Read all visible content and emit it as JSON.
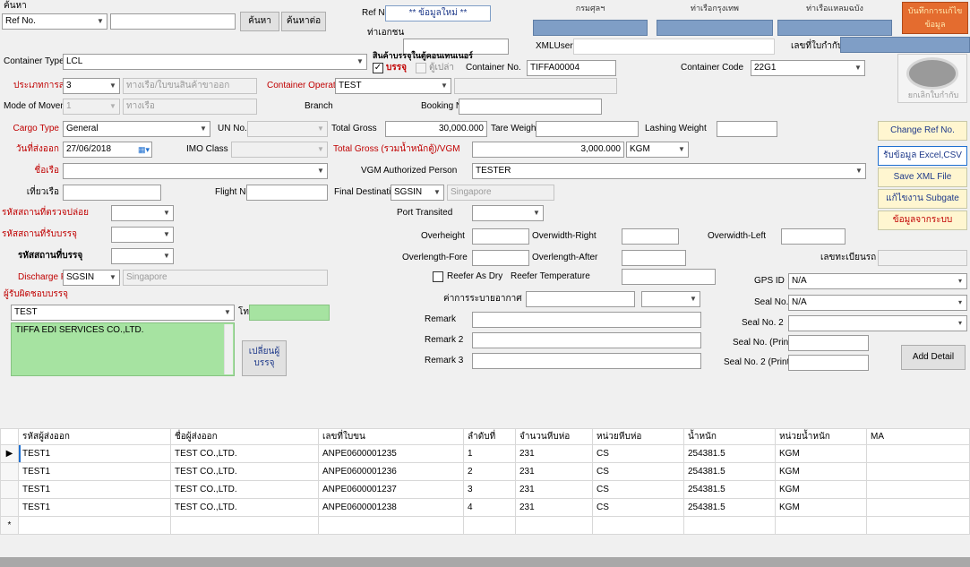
{
  "top": {
    "search_label": "ค้นหา",
    "search_field": "Ref No.",
    "search_value": "",
    "search_button": "ค้นหา",
    "advanced_search_button": "ค้นหาต่อ",
    "ref_no_label": "Ref No.",
    "ref_no_value": "** ข้อมูลใหม่ **",
    "col_status": "กรมศุลฯ",
    "col_sent": "ท่าเรือกรุงเทพ",
    "col_result": "ท่าเรือแหลมฉบัง",
    "save_button": "บันทึกการแก้ไขข้อมูล",
    "transporter_label": "ท่าเอกชน",
    "xml_user_label": "XMLUser ID",
    "reg_no_label": "เลขที่ใบกำกับฯ"
  },
  "container": {
    "type_label": "Container Type",
    "type_value": "LCL",
    "in_container_label": "สินค้าบรรจุในตู้คอนเทนเนอร์",
    "in_container_check": "บรรจุ",
    "empty_check": "ตู้เปล่า",
    "container_no_label": "Container No.",
    "container_no_value": "TIFFA00004",
    "container_code_label": "Container Code",
    "container_code_value": "22G1",
    "shipping_type_label": "ประเภทการส่งออก",
    "shipping_type_value": "3",
    "shipping_type_desc": "ทางเรือ/ใบขนสินค้าขาออก",
    "operator_label": "Container Operator",
    "operator_value": "TEST",
    "mode_label": "Mode of Movement",
    "mode_value": "1",
    "mode_desc": "ทางเรือ",
    "branch_label": "Branch",
    "booking_label": "Booking No.",
    "booking_value": ""
  },
  "cargo": {
    "cargo_type_label": "Cargo Type",
    "cargo_type_value": "General",
    "un_no_label": "UN No.",
    "total_gross_label": "Total Gross",
    "total_gross_value": "30,000.000",
    "tare_weight_label": "Tare Weight",
    "tare_weight_value": "",
    "lashing_weight_label": "Lashing Weight",
    "lashing_weight_value": "",
    "date_label": "วันที่ส่งออก",
    "date_value": "27/06/2018",
    "imo_label": "IMO Class",
    "vgm_label": "Total Gross (รวมน้ำหนักตู้)/VGM",
    "vgm_value": "3,000.000",
    "vgm_unit": "KGM",
    "vessel_label": "ชื่อเรือ",
    "vgm_auth_label": "VGM Authorized Person",
    "vgm_auth_value": "TESTER",
    "voyage_label": "เที่ยวเรือ",
    "flight_label": "Flight No.",
    "final_dest_label": "Final Destination",
    "final_dest_code": "SGSIN",
    "final_dest_name": "Singapore",
    "port_loading_label": "รหัสสถานที่ตรวจปล่อย",
    "port_transited_label": "Port Transited",
    "port_receive_label": "รหัสสถานที่รับบรรจุ",
    "overheight_label": "Overheight",
    "overwidth_right_label": "Overwidth-Right",
    "overwidth_left_label": "Overwidth-Left",
    "port_pack_label": "รหัสสถานที่บรรจุ",
    "overlength_fore_label": "Overlength-Fore",
    "overlength_after_label": "Overlength-After",
    "release_label": "เลขทะเบียนรถ",
    "discharge_label": "Discharge Port",
    "discharge_code": "SGSIN",
    "discharge_name": "Singapore",
    "reefer_label": "Reefer As Dry",
    "reefer_temp_label": "Reefer Temperature",
    "gps_label": "GPS ID",
    "gps_value": "N/A",
    "packer_label": "ผู้รับผิดชอบบรรจุ",
    "condition_label": "ค่าการระบายอากาศ",
    "seal_label": "Seal No.",
    "seal_value": "N/A",
    "packer_value": "TEST",
    "tel_label": "โทร",
    "remark_label": "Remark",
    "seal2_label": "Seal No. 2",
    "company_value": "TIFFA EDI SERVICES CO.,LTD.",
    "remark2_label": "Remark 2",
    "seal_print_label": "Seal No. (Print)",
    "edit_packer_button": "เปลี่ยนผู้บรรจุ",
    "remark3_label": "Remark 3",
    "seal2_print_label": "Seal No. 2 (Print)",
    "add_detail_button": "Add Detail"
  },
  "side": {
    "logo_caption": "ยกเลิกใบกำกับ",
    "change_ref": "Change Ref No.",
    "import_excel": "รับข้อมูล Excel,CSV",
    "save_xml": "Save XML File",
    "edit_subgate": "แก้ไขงาน Subgate",
    "more_info": "ข้อมูลจากระบบ"
  },
  "grid": {
    "headers": [
      "รหัสผู้ส่งออก",
      "ชื่อผู้ส่งออก",
      "เลขที่ใบขน",
      "ลำดับที่",
      "จำนวนหีบห่อ",
      "หน่วยหีบห่อ",
      "น้ำหนัก",
      "หน่วยน้ำหนัก",
      "MA"
    ],
    "rows": [
      [
        "TEST1",
        "TEST CO.,LTD.",
        "ANPE0600001235",
        "1",
        "231",
        "CS",
        "254381.5",
        "KGM",
        ""
      ],
      [
        "TEST1",
        "TEST CO.,LTD.",
        "ANPE0600001236",
        "2",
        "231",
        "CS",
        "254381.5",
        "KGM",
        ""
      ],
      [
        "TEST1",
        "TEST CO.,LTD.",
        "ANPE0600001237",
        "3",
        "231",
        "CS",
        "254381.5",
        "KGM",
        ""
      ],
      [
        "TEST1",
        "TEST CO.,LTD.",
        "ANPE0600001238",
        "4",
        "231",
        "CS",
        "254381.5",
        "KGM",
        ""
      ]
    ],
    "new_row_marker": "*",
    "current_row_marker": "▶"
  },
  "colors": {
    "accent_blue": "#7f9ec6",
    "save_button": "#e46c2f",
    "green_field": "#a6e3a1"
  }
}
